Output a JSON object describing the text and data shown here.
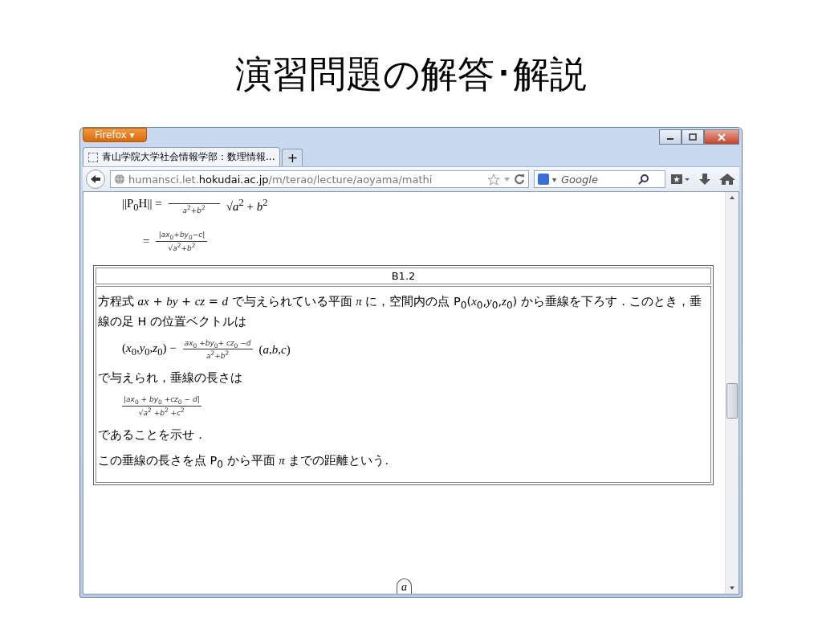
{
  "slide_title": "演習問題の解答･解説",
  "browser": {
    "menu_button": "Firefox ▾",
    "tabs": [
      {
        "title": "青山学院大学社会情報学部：数理情報...",
        "selected": true
      }
    ],
    "new_tab": "+",
    "url": {
      "prefix": "humansci.let.",
      "domain": "hokudai.ac.jp",
      "path": "/m/terao/lecture/aoyama/mathi"
    },
    "search": {
      "engine_caret": "▾",
      "placeholder": "Google"
    }
  },
  "top_equations": [
    {
      "lhs": "||P$_{0}$H||  =",
      "den": "*a*$^{2}$+*b*$^{2}$",
      "after": "√*a*$^{2}$ + *b*$^{2}$"
    },
    {
      "lhs": "=",
      "num": "|*ax*$_{0}$+*by*$_{0}$−*c*|",
      "den": "√*a*$^{2}$+*b*$^{2}$"
    }
  ],
  "problem": {
    "title": "B1.2",
    "blocks": [
      {
        "kind": "paragraph",
        "text": "方程式 *ax* + *by* + *cz* = *d* で与えられている平面 *π* に，空間内の点 P$_{0}$(*x*$_{0}$,*y*$_{0}$,*z*$_{0}$) から垂線を下ろす．このとき，垂線の足 H の位置ベクトルは"
      },
      {
        "kind": "equation",
        "parts": [
          {
            "kind": "text",
            "text": "(*x*$_{0}$,*y*$_{0}$,*z*$_{0}$) −"
          },
          {
            "kind": "fraction",
            "num": "*ax*$_{0}$ +*by*$_{0}$+ *cz*$_{0}$ −*d*",
            "den": "*a*$^{2}$+*b*$^{2}$"
          },
          {
            "kind": "text",
            "text": "(*a*,*b*,*c*)"
          }
        ]
      },
      {
        "kind": "paragraph",
        "text": "で与えられ，垂線の長さは"
      },
      {
        "kind": "equation",
        "parts": [
          {
            "kind": "fraction",
            "num": "|*ax*$_{0}$ + *by*$_{0}$ +*cz*$_{0}$ − *d*|",
            "den": "√*a*$^{2}$ +*b*$^{2}$ +*c*$^{2}$"
          }
        ]
      },
      {
        "kind": "paragraph",
        "text": "であることを示せ．"
      },
      {
        "kind": "paragraph",
        "text": "この垂線の長さを点 P$_{0}$ から平面 *π* までの距離という."
      }
    ]
  },
  "bottom_tab": "a"
}
